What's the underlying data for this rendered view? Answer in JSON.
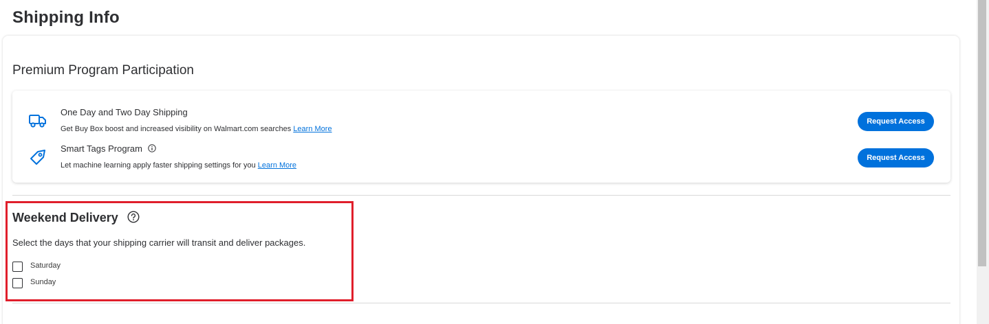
{
  "page": {
    "title": "Shipping Info"
  },
  "premium": {
    "section_title": "Premium Program Participation",
    "programs": [
      {
        "icon": "truck-icon",
        "name": "One Day and Two Day Shipping",
        "description": "Get Buy Box boost and increased visibility on Walmart.com searches",
        "link_label": "Learn More",
        "button_label": "Request Access"
      },
      {
        "icon": "tag-icon",
        "name": "Smart Tags Program",
        "description": "Let machine learning apply faster shipping settings for you",
        "link_label": "Learn More",
        "button_label": "Request Access"
      }
    ]
  },
  "weekend": {
    "title": "Weekend Delivery",
    "description": "Select the days that your shipping carrier will transit and deliver packages.",
    "options": [
      {
        "label": "Saturday",
        "checked": false
      },
      {
        "label": "Sunday",
        "checked": false
      }
    ]
  },
  "colors": {
    "accent": "#0071dc",
    "highlight": "#e01e2b",
    "text": "#2e2f32"
  }
}
